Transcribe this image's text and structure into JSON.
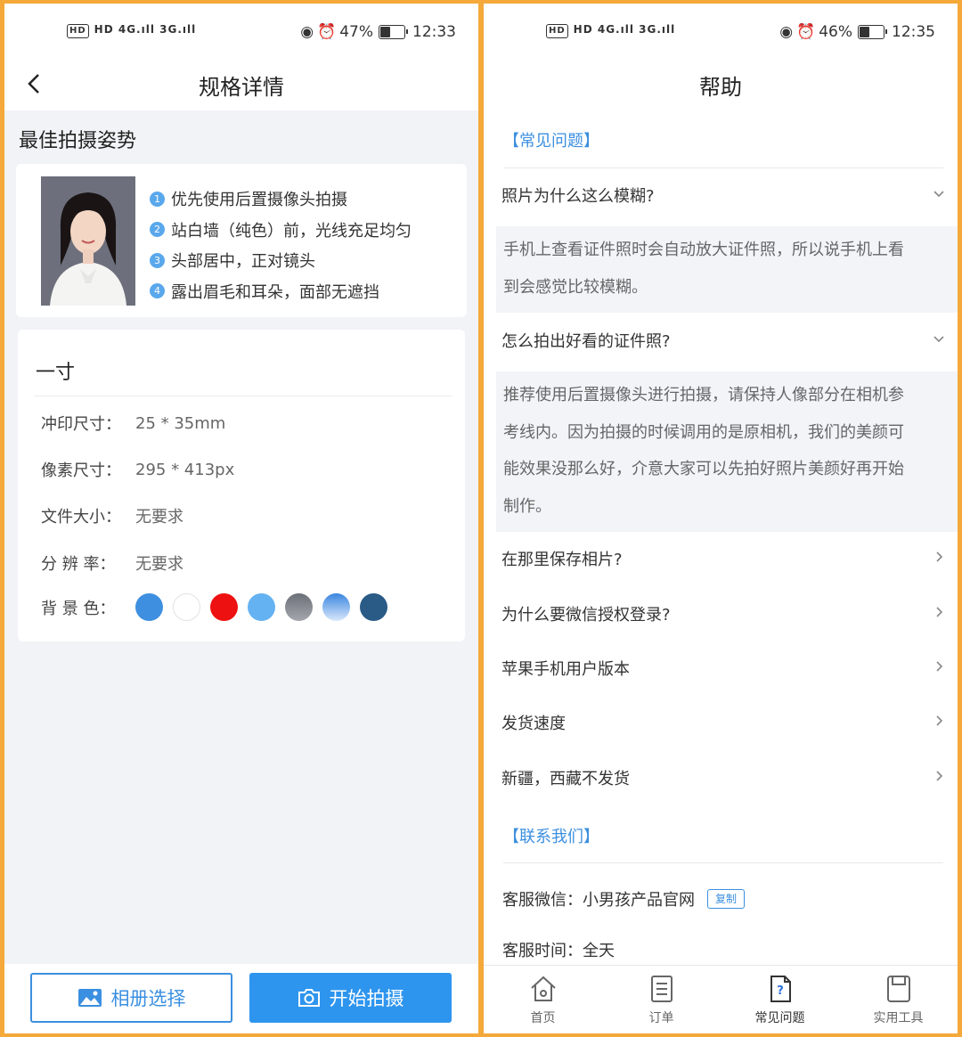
{
  "left": {
    "status": {
      "network": "HD  4G.ıll 3G.ıll",
      "battery": "47%",
      "battery_level": 0.47,
      "time": "12:33"
    },
    "nav_title": "规格详情",
    "pose": {
      "title": "最佳拍摄姿势",
      "tips": [
        {
          "num": "1",
          "text": "优先使用后置摄像头拍摄"
        },
        {
          "num": "2",
          "text": "站白墙（纯色）前，光线充足均匀"
        },
        {
          "num": "3",
          "text": "头部居中，正对镜头"
        },
        {
          "num": "4",
          "text": "露出眉毛和耳朵，面部无遮挡"
        }
      ]
    },
    "spec": {
      "title": "一寸",
      "rows": [
        {
          "label": "冲印尺寸：",
          "value": "25 * 35mm"
        },
        {
          "label": "像素尺寸：",
          "value": "295 * 413px"
        },
        {
          "label": "文件大小：",
          "value": "无要求"
        },
        {
          "label": "分 辨 率：",
          "value": "无要求"
        }
      ],
      "bg_label": "背 景 色：",
      "bg_colors": [
        "#3e8fe0",
        "#ffffff",
        "#ee1111",
        "#64b2f2",
        "linear-gradient(#6b6f77,#a4a7ad)",
        "linear-gradient(#3a86df,#d9e8fb)",
        "#2a5a86"
      ]
    },
    "buttons": {
      "album": "相册选择",
      "shoot": "开始拍摄"
    },
    "colors": {
      "accent": "#2e95ee"
    }
  },
  "right": {
    "status": {
      "network": "HD  4G.ıll 3G.ıll",
      "battery": "46%",
      "battery_level": 0.46,
      "time": "12:35"
    },
    "nav_title": "帮助",
    "faq_title": "【常见问题】",
    "faqs": [
      {
        "q": "照片为什么这么模糊?",
        "answer_lines": [
          "手机上查看证件照时会自动放大证件照，所以说手机上看",
          "到会感觉比较模糊。"
        ]
      },
      {
        "q": "怎么拍出好看的证件照?",
        "answer_lines": [
          "推荐使用后置摄像头进行拍摄，请保持人像部分在相机参",
          "考线内。因为拍摄的时候调用的是原相机，我们的美颜可",
          "能效果没那么好，介意大家可以先拍好照片美颜好再开始",
          "制作。"
        ]
      },
      {
        "q": "在那里保存相片?"
      },
      {
        "q": "为什么要微信授权登录?"
      },
      {
        "q": "苹果手机用户版本"
      },
      {
        "q": "发货速度"
      },
      {
        "q": "新疆，西藏不发货"
      }
    ],
    "contact_title": "【联系我们】",
    "contact": {
      "wechat": "客服微信：小男孩产品官网",
      "copy": "复制",
      "hours": "客服时间：全天"
    },
    "tabs": [
      {
        "label": "首页",
        "icon": "home-icon"
      },
      {
        "label": "订单",
        "icon": "order-icon"
      },
      {
        "label": "常见问题",
        "icon": "faq-icon"
      },
      {
        "label": "实用工具",
        "icon": "tools-icon"
      }
    ]
  }
}
